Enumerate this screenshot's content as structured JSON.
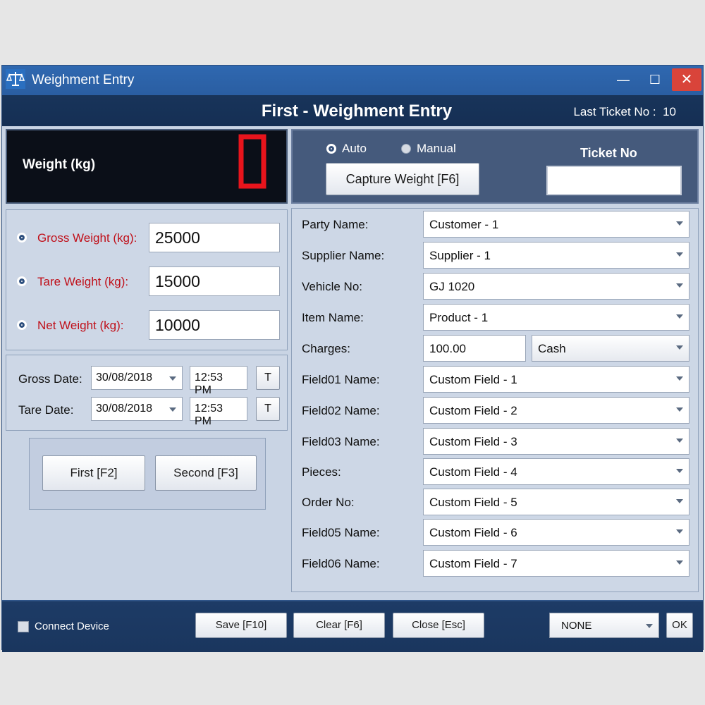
{
  "window": {
    "title": "Weighment Entry",
    "minimize": "—",
    "maximize": "☐",
    "close": "✕"
  },
  "header": {
    "title": "First - Weighment Entry",
    "last_ticket_label": "Last Ticket No :",
    "last_ticket_value": "10"
  },
  "weight": {
    "label": "Weight (kg)",
    "display_value": "0",
    "display_color": "#e8141c"
  },
  "capture": {
    "auto_label": "Auto",
    "manual_label": "Manual",
    "selected_mode": "Auto",
    "capture_button": "Capture Weight [F6]",
    "ticket_label": "Ticket No",
    "ticket_value": ""
  },
  "weights": [
    {
      "label": "Gross Weight (kg):",
      "value": "25000"
    },
    {
      "label": "Tare Weight (kg):",
      "value": "15000"
    },
    {
      "label": "Net Weight (kg):",
      "value": "10000"
    }
  ],
  "dates": {
    "gross": {
      "label": "Gross Date:",
      "date": "30/08/2018",
      "time": "12:53 PM",
      "button": "T"
    },
    "tare": {
      "label": "Tare  Date:",
      "date": "30/08/2018",
      "time": "12:53 PM",
      "button": "T"
    }
  },
  "actions": {
    "first": "First [F2]",
    "second": "Second [F3]"
  },
  "form": {
    "party": {
      "label": "Party Name:",
      "value": "Customer - 1"
    },
    "supplier": {
      "label": "Supplier Name:",
      "value": "Supplier - 1"
    },
    "vehicle": {
      "label": "Vehicle No:",
      "value": "GJ 1020"
    },
    "item": {
      "label": "Item Name:",
      "value": "Product - 1"
    },
    "charges": {
      "label": "Charges:",
      "value": "100.00",
      "mode": "Cash"
    },
    "field01": {
      "label": "Field01 Name:",
      "value": "Custom Field - 1"
    },
    "field02": {
      "label": "Field02 Name:",
      "value": "Custom Field - 2"
    },
    "field03": {
      "label": "Field03 Name:",
      "value": "Custom Field - 3"
    },
    "pieces": {
      "label": "Pieces:",
      "value": "Custom Field - 4"
    },
    "order": {
      "label": "Order No:",
      "value": "Custom Field - 5"
    },
    "field05": {
      "label": "Field05 Name:",
      "value": "Custom Field - 6"
    },
    "field06": {
      "label": "Field06 Name:",
      "value": "Custom Field - 7"
    }
  },
  "footer": {
    "connect_label": "Connect Device",
    "save": "Save [F10]",
    "clear": "Clear [F6]",
    "close": "Close [Esc]",
    "device_select": "NONE",
    "ok": "OK"
  }
}
